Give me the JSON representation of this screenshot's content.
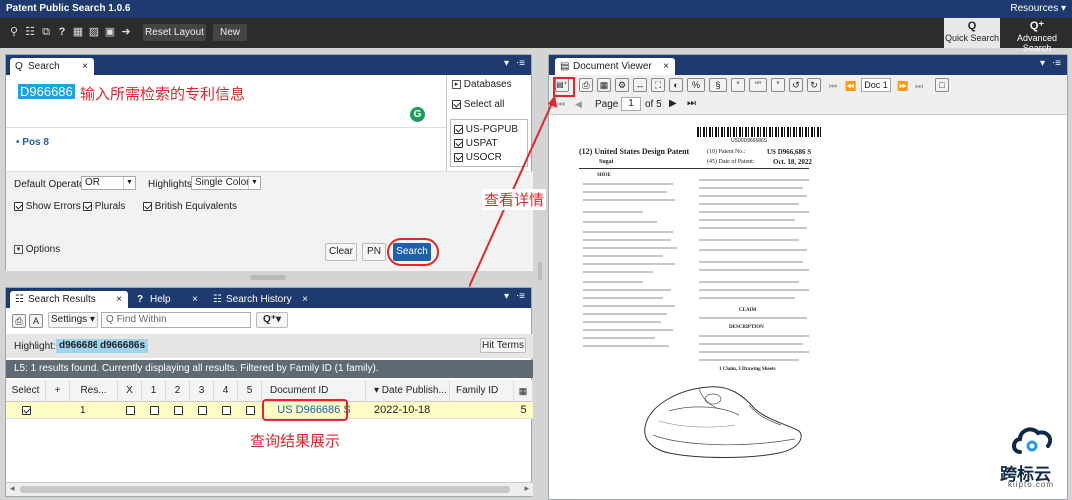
{
  "app": {
    "title": "Patent Public Search 1.0.6",
    "resources": "Resources ▾"
  },
  "toolbar": {
    "reset_layout": "Reset Layout",
    "new": "New",
    "quick_search": "Quick Search",
    "advanced_search": "Advanced Search"
  },
  "search_panel": {
    "tab": "Search",
    "query": "D966686",
    "annotation": "输入所需检索的专利信息",
    "pos_line": "• Pos 8",
    "databases_label": "Databases",
    "select_all": "Select all",
    "databases": [
      "US-PGPUB",
      "USPAT",
      "USOCR"
    ],
    "default_operator_label": "Default Operator:",
    "default_operator": "OR",
    "highlights_label": "Highlights:",
    "highlights_value": "Single Color",
    "show_errors": "Show Errors",
    "plurals": "Plurals",
    "british_equivalents": "British Equivalents",
    "options": "Options",
    "clear": "Clear",
    "pn": "PN",
    "search": "Search"
  },
  "results_panel": {
    "tabs": [
      "Search Results",
      "Help",
      "Search History"
    ],
    "settings": "Settings",
    "find_placeholder": "Find Within",
    "highlight_label": "Highlight:",
    "highlight_terms": [
      "d966686",
      "d966686s"
    ],
    "hit_terms": "Hit Terms",
    "status": "L5: 1 results found. Currently displaying all results. Filtered by Family ID (1 family).",
    "columns": [
      "Select",
      "+",
      "Res...",
      "X",
      "1",
      "2",
      "3",
      "4",
      "5",
      "Document ID",
      "▾ Date Publish...",
      "Family ID"
    ],
    "row": {
      "result": "1",
      "document_id": "US D966686 S",
      "date": "2022-10-18",
      "count": "5"
    },
    "annotation": "查询结果展示"
  },
  "viewer": {
    "tab": "Document Viewer",
    "doc_label": "Doc 1",
    "page_label": "Page",
    "page_value": "1",
    "page_of": "of 5",
    "annotation": "查看详情",
    "patent": {
      "barcode_text": "US00D966686S",
      "kind": "(12) United States Design Patent",
      "applicant": "Sugai",
      "patent_no_label": "(10) Patent No.:",
      "patent_no": "US D966,686 S",
      "date_label": "(45) Date of Patent:",
      "date": "Oct. 18, 2022",
      "title": "SHOE",
      "claim_heading": "CLAIM",
      "description_heading": "DESCRIPTION",
      "figure_caption": "1 Claim, 3 Drawing Sheets"
    }
  },
  "watermark": {
    "name": "跨标云",
    "url": "kiipto.com"
  },
  "colors": {
    "nav": "#1e3a6e",
    "accent": "#1aa3e8",
    "annotation": "#e2262c"
  }
}
